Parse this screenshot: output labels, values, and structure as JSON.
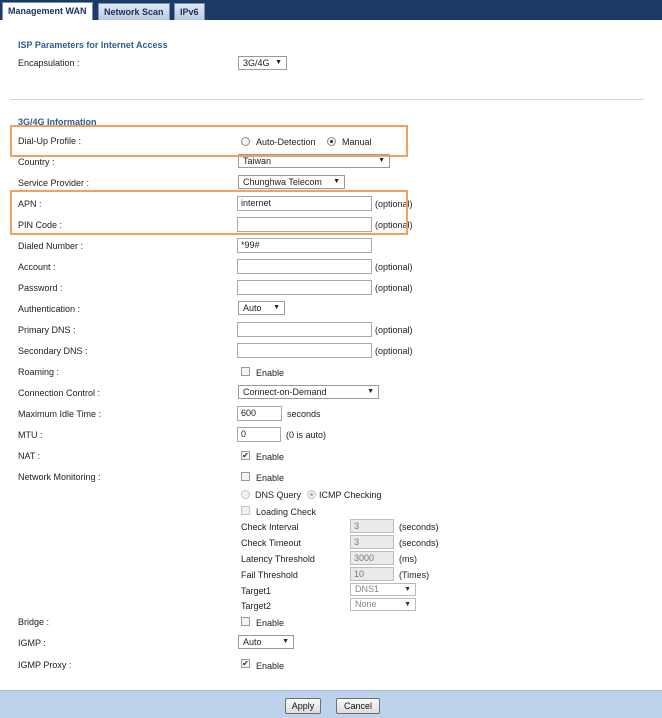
{
  "tabs": [
    "Management WAN",
    "Network Scan",
    "IPv6"
  ],
  "isp": {
    "title": "ISP Parameters for Internet Access",
    "encapsulation_label": "Encapsulation :",
    "encapsulation_value": "3G/4G"
  },
  "g34": {
    "title": "3G/4G Information",
    "dialup_label": "Dial-Up Profile :",
    "dialup_options": [
      "Auto-Detection",
      "Manual"
    ],
    "dialup_selected": "Manual",
    "country_label": "Country :",
    "country_value": "Taiwan",
    "provider_label": "Service Provider :",
    "provider_value": "Chunghwa Telecom",
    "apn_label": "APN :",
    "apn_value": "internet",
    "pin_label": "PIN Code :",
    "pin_value": "",
    "dialed_label": "Dialed Number :",
    "dialed_value": "*99#",
    "account_label": "Account :",
    "account_value": "",
    "password_label": "Password :",
    "password_value": "",
    "auth_label": "Authentication :",
    "auth_value": "Auto",
    "pdns_label": "Primary DNS :",
    "pdns_value": "",
    "sdns_label": "Secondary DNS :",
    "sdns_value": "",
    "roaming_label": "Roaming :",
    "conn_label": "Connection Control :",
    "conn_value": "Connect-on-Demand",
    "idle_label": "Maximum Idle Time :",
    "idle_value": "600",
    "idle_unit": "seconds",
    "mtu_label": "MTU :",
    "mtu_value": "0",
    "mtu_hint": "(0 is auto)",
    "nat_label": "NAT :",
    "netmon_label": "Network Monitoring :",
    "netmon_options": [
      "DNS Query",
      "ICMP Checking"
    ],
    "loading_check": "Loading Check",
    "check_interval_label": "Check Interval",
    "check_interval_value": "3",
    "check_interval_unit": "(seconds)",
    "check_timeout_label": "Check Timeout",
    "check_timeout_value": "3",
    "check_timeout_unit": "(seconds)",
    "latency_label": "Latency Threshold",
    "latency_value": "3000",
    "latency_unit": "(ms)",
    "fail_label": "Fail Threshold",
    "fail_value": "10",
    "fail_unit": "(Times)",
    "target1_label": "Target1",
    "target1_value": "DNS1",
    "target2_label": "Target2",
    "target2_value": "None",
    "bridge_label": "Bridge :",
    "igmp_label": "IGMP :",
    "igmp_value": "Auto",
    "igmp_proxy_label": "IGMP Proxy :",
    "optional": "(optional)",
    "enable": "Enable"
  },
  "footer": {
    "apply": "Apply",
    "cancel": "Cancel"
  },
  "colors": {
    "topbar": "#1b3a68",
    "section_title": "#2f5b93",
    "highlight": "#f0a060",
    "footer": "#bdd3ec"
  }
}
